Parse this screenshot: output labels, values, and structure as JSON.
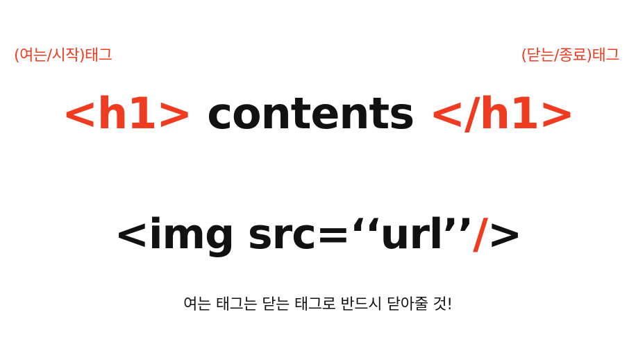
{
  "colors": {
    "accent": "#ef3b1f",
    "text": "#111111",
    "background": "#ffffff"
  },
  "labels": {
    "opening": "(여는/시작)태그",
    "closing": "(닫는/종료)태그"
  },
  "h1_example": {
    "open_tag": "<h1>",
    "content": "contents",
    "close_tag": "</h1>"
  },
  "img_example": {
    "prefix": "<img src=‘‘url’’",
    "slash": "/",
    "suffix": ">"
  },
  "note": "여는 태그는 닫는 태그로 반드시 닫아줄 것!"
}
